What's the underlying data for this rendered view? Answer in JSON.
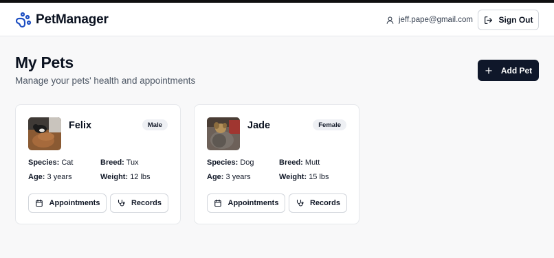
{
  "header": {
    "brand_name": "PetManager",
    "brand_icon": "paw-icon",
    "user_email": "jeff.pape@gmail.com",
    "user_icon": "user-icon",
    "signout_label": "Sign Out",
    "signout_icon": "log-out-icon"
  },
  "page": {
    "title": "My Pets",
    "subtitle": "Manage your pets' health and appointments",
    "add_pet_label": "Add Pet",
    "add_pet_icon": "plus-icon"
  },
  "pets": [
    {
      "name": "Felix",
      "gender": "Male",
      "species_label": "Species:",
      "species": "Cat",
      "breed_label": "Breed:",
      "breed": "Tux",
      "age_label": "Age:",
      "age": "3 years",
      "weight_label": "Weight:",
      "weight": "12 lbs",
      "appointments_label": "Appointments",
      "records_label": "Records"
    },
    {
      "name": "Jade",
      "gender": "Female",
      "species_label": "Species:",
      "species": "Dog",
      "breed_label": "Breed:",
      "breed": "Mutt",
      "age_label": "Age:",
      "age": "3 years",
      "weight_label": "Weight:",
      "weight": "15 lbs",
      "appointments_label": "Appointments",
      "records_label": "Records"
    }
  ],
  "colors": {
    "primary": "#0f172a",
    "accent": "#1e4fc2",
    "badge_bg": "#eef0f4",
    "border": "#e5e7eb"
  }
}
